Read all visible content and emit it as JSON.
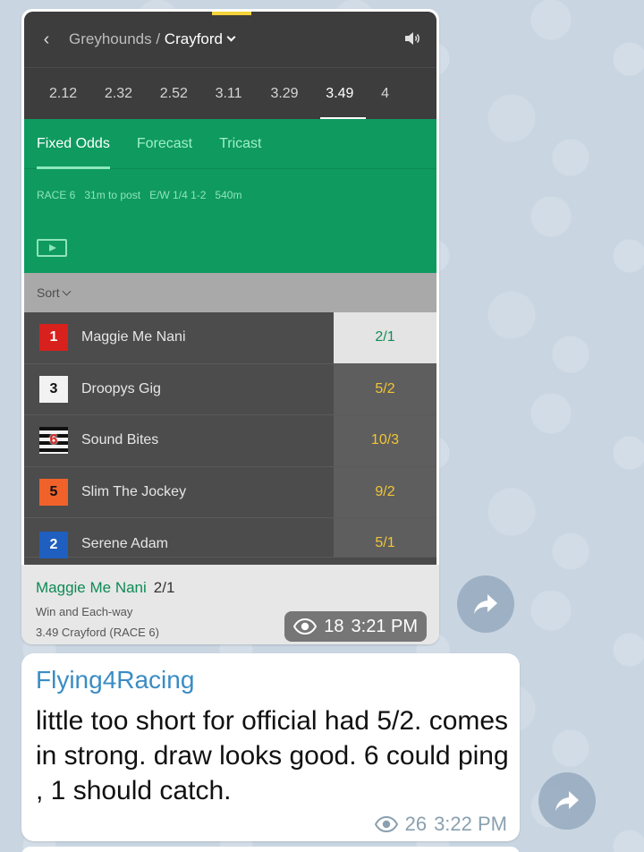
{
  "header": {
    "back_icon": "‹",
    "category": "Greyhounds",
    "separator": " / ",
    "venue": "Crayford"
  },
  "race_times": [
    {
      "label": "2.12",
      "active": false
    },
    {
      "label": "2.32",
      "active": false
    },
    {
      "label": "2.52",
      "active": false
    },
    {
      "label": "3.11",
      "active": false
    },
    {
      "label": "3.29",
      "active": false
    },
    {
      "label": "3.49",
      "active": true
    },
    {
      "label": "4",
      "active": false
    }
  ],
  "bet_tabs": [
    {
      "label": "Fixed Odds",
      "active": true
    },
    {
      "label": "Forecast",
      "active": false
    },
    {
      "label": "Tricast",
      "active": false
    }
  ],
  "race_info": {
    "race": "RACE 6",
    "to_post": "31m to post",
    "each_way": "E/W 1/4 1-2",
    "distance": "540m"
  },
  "sort": {
    "label": "Sort"
  },
  "runners": [
    {
      "trap": "1",
      "name": "Maggie Me Nani",
      "odds": "2/1",
      "selected": true,
      "trap_bg": "#d8211d",
      "trap_fg": "#ffffff"
    },
    {
      "trap": "3",
      "name": "Droopys Gig",
      "odds": "5/2",
      "selected": false,
      "trap_bg": "#f2f2f2",
      "trap_fg": "#111111"
    },
    {
      "trap": "6",
      "name": "Sound Bites",
      "odds": "10/3",
      "selected": false,
      "trap_bg": "stripes",
      "trap_fg": "#d8211d"
    },
    {
      "trap": "5",
      "name": "Slim The Jockey",
      "odds": "9/2",
      "selected": false,
      "trap_bg": "#f0622a",
      "trap_fg": "#111111"
    },
    {
      "trap": "2",
      "name": "Serene Adam",
      "odds": "5/1",
      "selected": false,
      "trap_bg": "#1f5fbf",
      "trap_fg": "#ffffff"
    }
  ],
  "bet_slip": {
    "selection": "Maggie Me Nani",
    "odds": "2/1",
    "market": "Win and Each-way",
    "race_label": "3.49 Crayford (RACE 6)"
  },
  "screenshot_msg": {
    "views": "18",
    "time": "3:21 PM"
  },
  "text_msg": {
    "author": "Flying4Racing",
    "body": "little too short for official had 5/2. comes in strong. draw looks good. 6 could ping , 1 should catch.",
    "views": "26",
    "time": "3:22 PM"
  },
  "colors": {
    "accent_green": "#0f9a5f",
    "odds_yellow": "#f2c535",
    "author_blue": "#3a8cc4"
  }
}
